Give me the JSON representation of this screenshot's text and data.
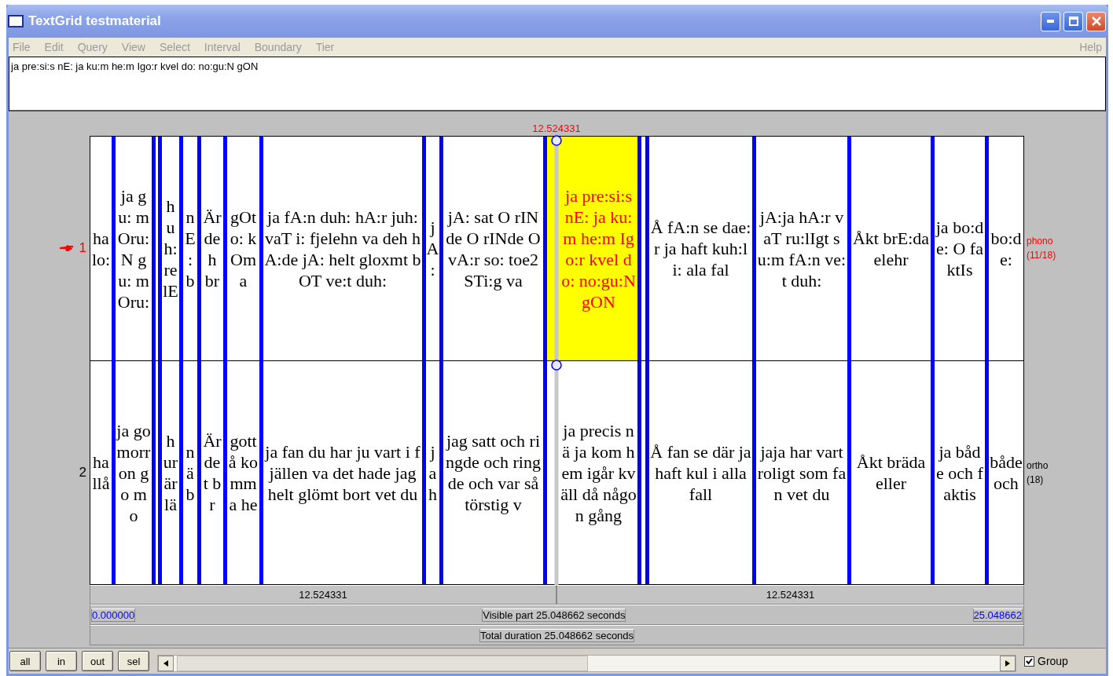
{
  "window": {
    "title": "TextGrid testmaterial"
  },
  "menu": [
    {
      "label": "File"
    },
    {
      "label": "Edit"
    },
    {
      "label": "Query"
    },
    {
      "label": "View"
    },
    {
      "label": "Select"
    },
    {
      "label": "Interval"
    },
    {
      "label": "Boundary"
    },
    {
      "label": "Tier"
    }
  ],
  "help": {
    "label": "Help"
  },
  "text_field": {
    "value": "ja pre:si:s nE: ja ku:m he:m Igo:r kvel do: no:gu:N gON"
  },
  "cursor_time": "12.524331",
  "tiers": [
    {
      "number": "1",
      "name": "phono",
      "count": "(11/18)",
      "selected": true,
      "intervals": [
        {
          "text": "halo:",
          "selected": false
        },
        {
          "text": "ja gu: mOru:N gu: mOru:",
          "selected": false
        },
        {
          "selected": false
        },
        {
          "text": "huh:relE",
          "selected": false
        },
        {
          "text": "nE:b",
          "selected": false
        },
        {
          "text": "Är deh br",
          "selected": false
        },
        {
          "text": "gOt o: kOma",
          "selected": false
        },
        {
          "text": "ja fA:n duh: hA:r juh: vaT i: fjelehn va deh hA:de jA: helt gloxmt bOT ve:t duh:",
          "selected": false
        },
        {
          "text": "jA:",
          "selected": false
        },
        {
          "text": "jA: sat O rINde O rINde O vA:r so: toe2STi:g va",
          "selected": false
        },
        {
          "text": "ja pre:si:s nE: ja ku:m he:m Igo:r kvel do: no:gu:N gON",
          "selected": true
        },
        {
          "selected": false
        },
        {
          "text": "Å fA:n se dae:r ja haft kuh:l i: ala fal",
          "selected": false
        },
        {
          "text": "jA:ja hA:r vaT ru:lIgt su:m fA:n ve:t duh:",
          "selected": false
        },
        {
          "text": "Åkt brE:da elehr",
          "selected": false
        },
        {
          "text": "ja bo:de: O faktIs",
          "selected": false
        },
        {
          "text": "bo:de:",
          "selected": false
        }
      ]
    },
    {
      "number": "2",
      "name": "ortho",
      "count": "(18)",
      "selected": false,
      "intervals": [
        {
          "text": "hallå",
          "selected": false
        },
        {
          "text": "ja go morron go mo",
          "selected": false
        },
        {
          "selected": false
        },
        {
          "text": "hur är lä",
          "selected": false
        },
        {
          "text": "nä b",
          "selected": false
        },
        {
          "text": "Är det br",
          "selected": false
        },
        {
          "text": "gott å komma he",
          "selected": false
        },
        {
          "text": "ja fan du har ju vart i fjällen va det hade jag helt glömt bort vet du",
          "selected": false
        },
        {
          "text": "jah",
          "selected": false
        },
        {
          "text": "jag satt och ringde och ringde och var så törstig v",
          "selected": false
        },
        {
          "text": "ja precis nä ja kom hem igår kväll då någon gång",
          "selected": false
        },
        {
          "selected": false
        },
        {
          "text": "Å fan se där ja haft kul i alla fall",
          "selected": false
        },
        {
          "text": "jaja har vart roligt som fan vet du",
          "selected": false
        },
        {
          "text": "Åkt bräda eller",
          "selected": false
        },
        {
          "text": "ja både och faktis",
          "selected": false
        },
        {
          "text": "både och",
          "selected": false
        }
      ]
    }
  ],
  "time_rows": {
    "left_half": "12.524331",
    "right_half": "12.524331",
    "start": "0.000000",
    "visible": "Visible part 25.048662 seconds",
    "end": "25.048662",
    "total": "Total duration 25.048662 seconds"
  },
  "buttons": [
    {
      "label": "all"
    },
    {
      "label": "in"
    },
    {
      "label": "out"
    },
    {
      "label": "sel"
    }
  ],
  "group": {
    "label": "Group",
    "checked": true
  }
}
